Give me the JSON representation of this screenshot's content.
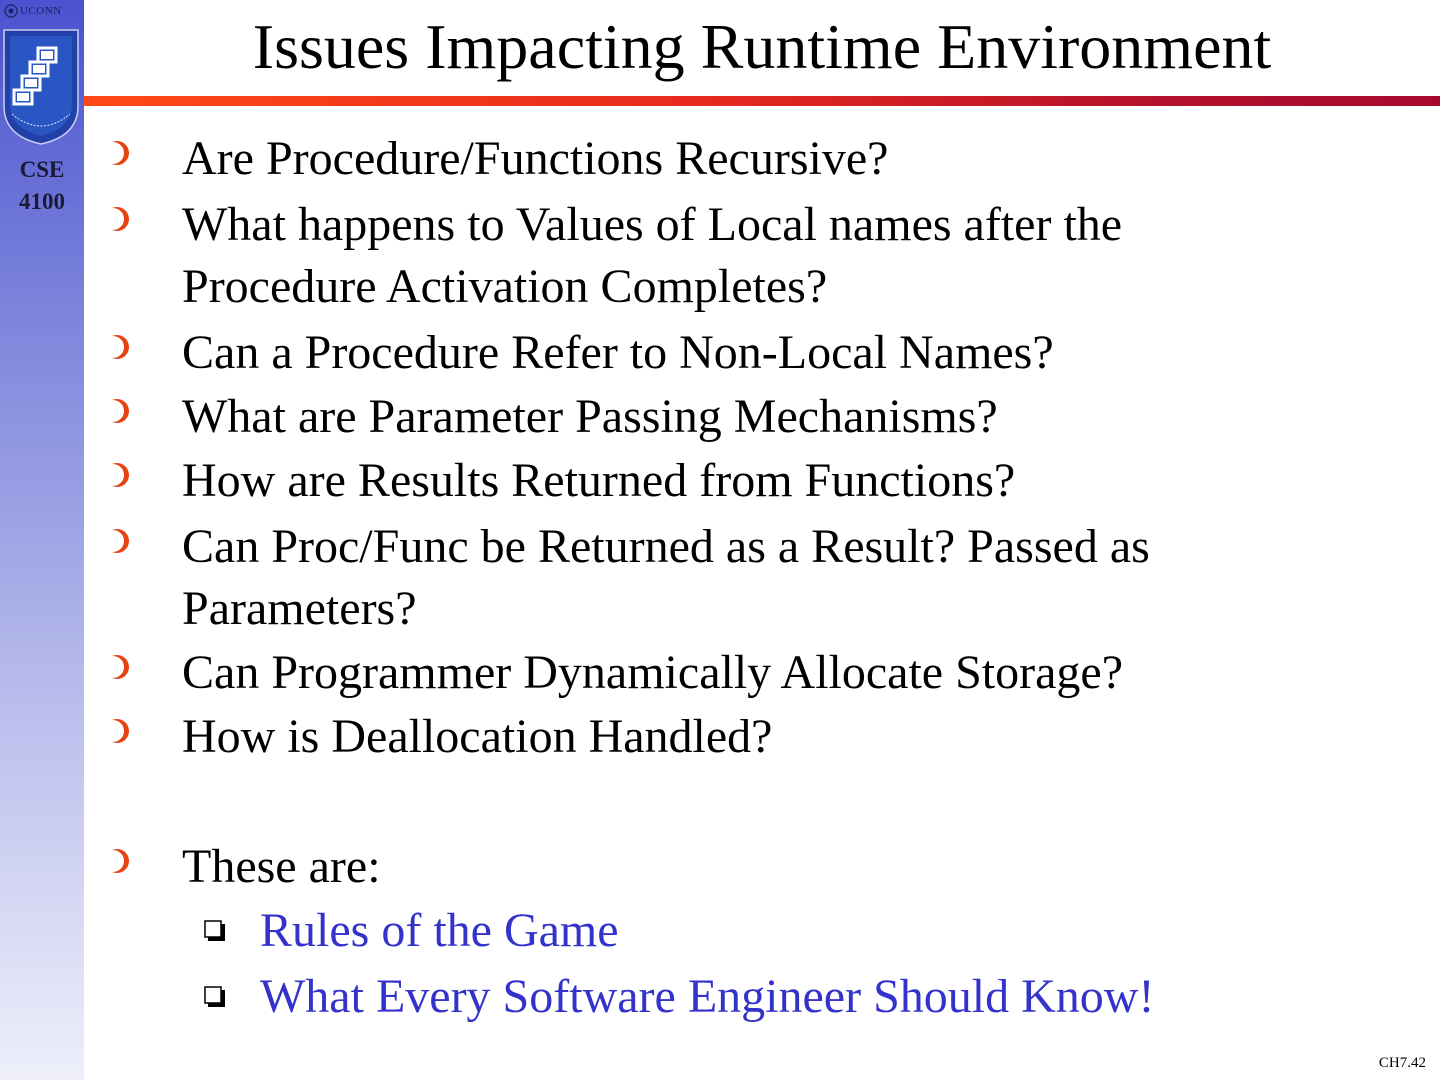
{
  "sidebar": {
    "uconn_text": "UCONN",
    "course_line1": "CSE",
    "course_line2": "4100",
    "logo_ring_text": "Computer Science and Engineering",
    "logo_icon": "linked-windows-logo"
  },
  "slide": {
    "title": "Issues Impacting Runtime Environment",
    "bullets": [
      {
        "lines": [
          "Are Procedure/Functions Recursive?"
        ]
      },
      {
        "lines": [
          "What happens to Values of Local names after the",
          "Procedure Activation Completes?"
        ]
      },
      {
        "lines": [
          "Can a Procedure Refer to Non-Local Names?"
        ]
      },
      {
        "lines": [
          "What are Parameter Passing Mechanisms?"
        ]
      },
      {
        "lines": [
          "How are Results Returned from Functions?"
        ]
      },
      {
        "lines": [
          "Can Proc/Func be Returned as a Result? Passed as",
          "Parameters?"
        ]
      },
      {
        "lines": [
          "Can Programmer Dynamically Allocate Storage?"
        ]
      },
      {
        "lines": [
          "How is Deallocation Handled?"
        ]
      },
      {
        "lines": [
          "These are:"
        ]
      }
    ],
    "sub_bullets": [
      "Rules of the Game",
      "What Every Software Engineer Should Know!"
    ],
    "page_number": "CH7.42"
  },
  "colors": {
    "bullet": "#e8420f",
    "sub_bullet_text": "#3333cc",
    "sidebar_top": "#4a52cf",
    "title_rule": "#d32020"
  },
  "icons": {
    "bullet": "circle-bullet-icon",
    "sub_bullet": "square-bullet-icon"
  }
}
